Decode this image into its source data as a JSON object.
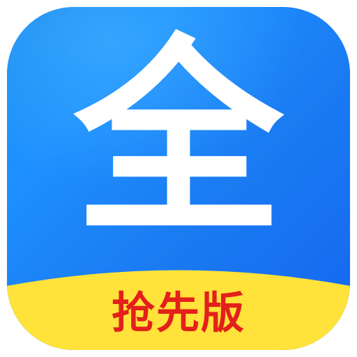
{
  "app_icon": {
    "glyph": "全",
    "badge_label": "抢先版",
    "colors": {
      "background_top": "#1e90ff",
      "background_bottom": "#1566ef",
      "glyph": "#ffffff",
      "badge_background": "#ffe23a",
      "badge_text": "#e3201b"
    }
  }
}
